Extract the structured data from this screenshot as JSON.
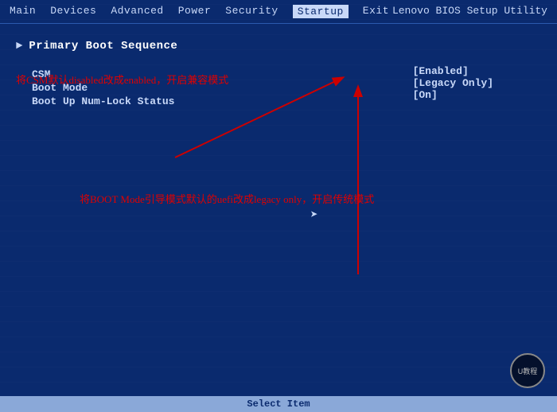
{
  "bios": {
    "title": "Lenovo BIOS Setup Utility",
    "menu_items": [
      {
        "label": "Main",
        "active": false
      },
      {
        "label": "Devices",
        "active": false
      },
      {
        "label": "Advanced",
        "active": false
      },
      {
        "label": "Power",
        "active": false
      },
      {
        "label": "Security",
        "active": false
      },
      {
        "label": "Startup",
        "active": true
      },
      {
        "label": "Exit",
        "active": false
      }
    ],
    "section_title": "Primary Boot Sequence",
    "settings": [
      {
        "label": "CSM",
        "value": ""
      },
      {
        "label": "Boot Mode",
        "value": ""
      },
      {
        "label": "Boot Up Num-Lock Status",
        "value": ""
      }
    ],
    "values": [
      {
        "value": "[Enabled]"
      },
      {
        "value": "[Legacy Only]"
      },
      {
        "value": "[On]"
      }
    ],
    "annotation1": "将CSM默认disabled改成enabled，开启兼容模式",
    "annotation2": "将BOOT Mode引导模式默认的uefi改成legacy only，开启传统模式",
    "bottom_bar": "Select Item"
  }
}
